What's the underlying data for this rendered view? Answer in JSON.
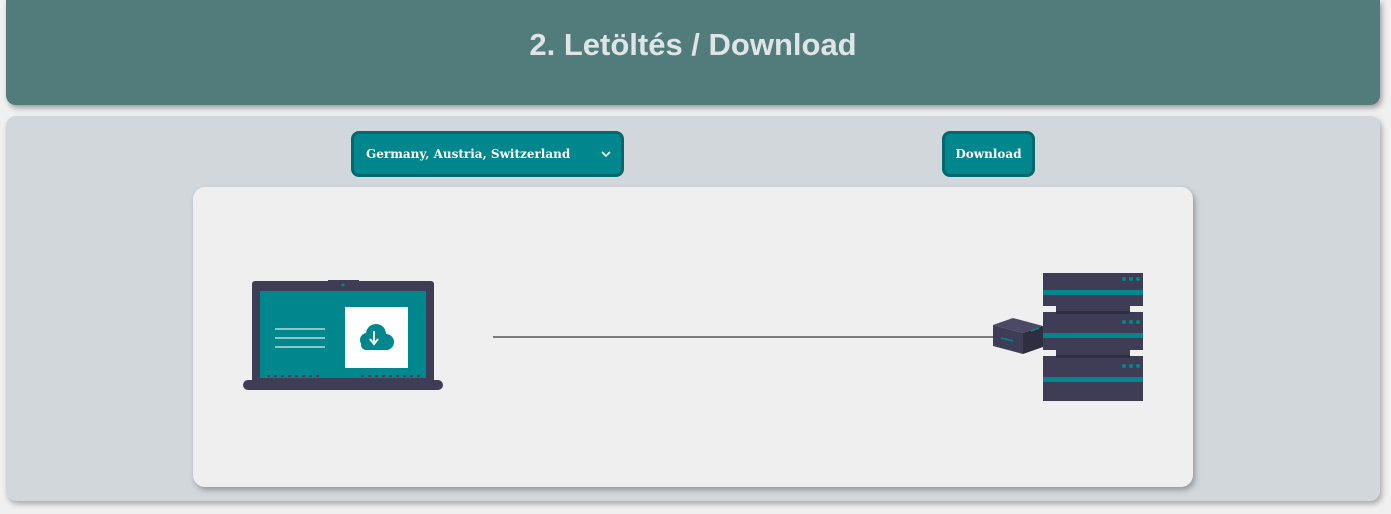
{
  "header": {
    "title": "2. Letöltés / Download"
  },
  "controls": {
    "region_select": {
      "selected": "Germany, Austria, Switzerland",
      "icon": "chevron-down-icon"
    },
    "download_label": "Download"
  },
  "illustration": {
    "client_icon": "laptop-icon",
    "client_screen_icon": "cloud-download-icon",
    "connection": "network-line",
    "package_icon": "package-icon",
    "server_icon": "server-rack-icon"
  },
  "colors": {
    "header_bg": "#527b7c",
    "panel_bg": "#d2d7db",
    "card_bg": "#efefef",
    "accent": "#00878d",
    "accent_border": "#03696e",
    "device_dark": "#3f3d56"
  }
}
